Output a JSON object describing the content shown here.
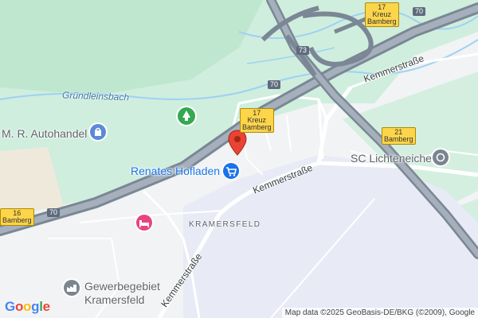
{
  "map": {
    "labels": {
      "creek": "Gründleinsbach",
      "autohandel": "M. R. Autohandel",
      "hofladen": "Renates Hofladen",
      "sc": "SC Lichteneiche",
      "district": "KRAMERSFELD",
      "gewerbe_line1": "Gewerbegebiet",
      "gewerbe_line2": "Kramersfeld",
      "street_top": "Kemmerstraße",
      "street_mid": "Kemmerstraße",
      "street_bottom": "Kemmerstraße"
    },
    "shields": {
      "exit17_top": {
        "num": "17",
        "line1": "Kreuz",
        "line2": "Bamberg"
      },
      "exit17_mid": {
        "num": "17",
        "line1": "Kreuz",
        "line2": "Bamberg"
      },
      "exit21": {
        "num": "21",
        "line1": "Bamberg"
      },
      "exit16": {
        "num": "16",
        "line1": "Bamberg"
      }
    },
    "highways": {
      "a70_top": "70",
      "a73": "73",
      "a70_mid": "70",
      "a70_left": "70"
    },
    "attribution": "Map data ©2025 GeoBasis-DE/BKG (©2009), Google",
    "logo": "Google",
    "icons": [
      "park-icon",
      "shop-icon",
      "cart-icon",
      "hotel-icon",
      "sport-icon",
      "industrial-icon",
      "location-pin-icon"
    ]
  }
}
